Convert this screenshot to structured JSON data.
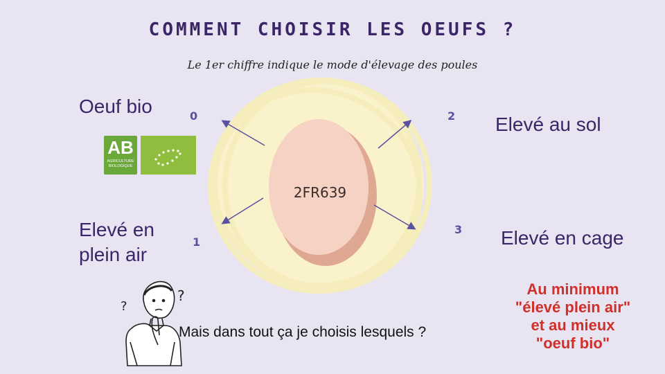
{
  "title": "COMMENT CHOISIR LES OEUFS ?",
  "subtitle": "Le 1er chiffre indique le mode d'élevage des poules",
  "egg_code": "2FR639",
  "categories": [
    {
      "number": "0",
      "label": "Oeuf bio"
    },
    {
      "number": "1",
      "label_line1": "Elevé en",
      "label_line2": "plein air"
    },
    {
      "number": "2",
      "label": "Elevé au sol"
    },
    {
      "number": "3",
      "label": "Elevé en cage"
    }
  ],
  "logos": {
    "ab_text": "AB",
    "ab_subtext_line1": "AGRICULTURE",
    "ab_subtext_line2": "BIOLOGIQUE",
    "eu_icon": "eu-organic-leaf-icon"
  },
  "question": "Mais dans tout ça je choisis lesquels ?",
  "advice": {
    "line1": "Au minimum",
    "line2": "\"élevé plein air\"",
    "line3": "et au mieux",
    "line4": "\"oeuf bio\""
  },
  "colors": {
    "background": "#e8e4f2",
    "title": "#3b2567",
    "advice": "#d0302a",
    "egg": "#f5d2c4",
    "egg_shadow": "#dfa892",
    "glow": "#fbf4c6",
    "arrow": "#5a52a0"
  }
}
